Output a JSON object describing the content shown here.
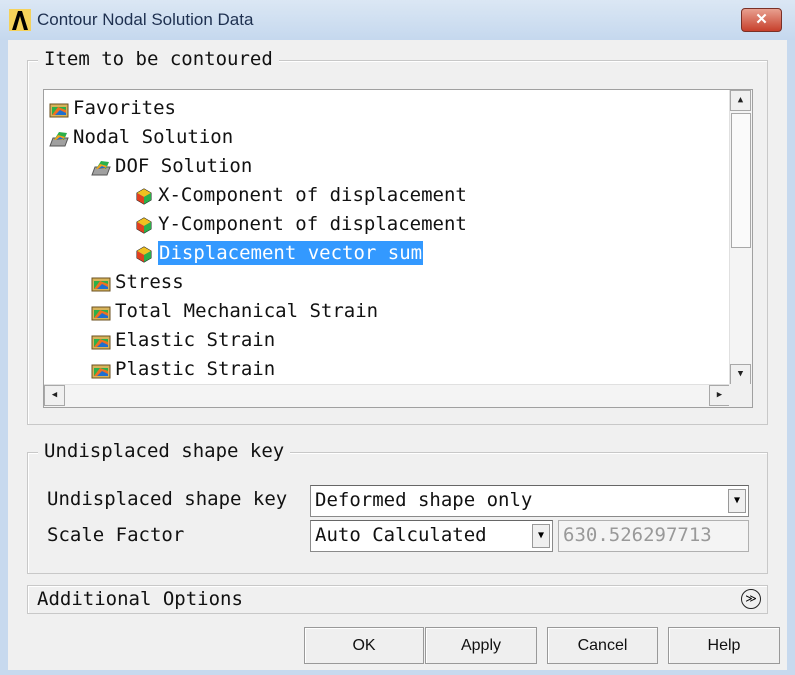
{
  "window": {
    "title": "Contour Nodal Solution Data",
    "close": "✕"
  },
  "item_group": {
    "label": "Item to be contoured",
    "tree": [
      {
        "label": "Favorites",
        "level": 0,
        "icon": "folder-contour-icon"
      },
      {
        "label": "Nodal Solution",
        "level": 0,
        "icon": "open-folder-contour-icon"
      },
      {
        "label": "DOF Solution",
        "level": 1,
        "icon": "open-folder-contour-icon"
      },
      {
        "label": "X-Component of displacement",
        "level": 2,
        "icon": "cube-contour-icon"
      },
      {
        "label": "Y-Component of displacement",
        "level": 2,
        "icon": "cube-contour-icon"
      },
      {
        "label": "Displacement vector sum",
        "level": 2,
        "icon": "cube-contour-icon",
        "selected": true
      },
      {
        "label": "Stress",
        "level": 1,
        "icon": "folder-contour-icon"
      },
      {
        "label": "Total Mechanical Strain",
        "level": 1,
        "icon": "folder-contour-icon"
      },
      {
        "label": "Elastic Strain",
        "level": 1,
        "icon": "folder-contour-icon"
      },
      {
        "label": "Plastic Strain",
        "level": 1,
        "icon": "folder-contour-icon"
      }
    ]
  },
  "shape_group": {
    "label": "Undisplaced shape key",
    "key_label": "Undisplaced shape key",
    "key_value": "Deformed shape only",
    "scale_label": "Scale Factor",
    "scale_value": "Auto Calculated",
    "scale_number": "630.526297713"
  },
  "additional": {
    "label": "Additional Options"
  },
  "buttons": {
    "ok": "OK",
    "apply": "Apply",
    "cancel": "Cancel",
    "help": "Help"
  }
}
